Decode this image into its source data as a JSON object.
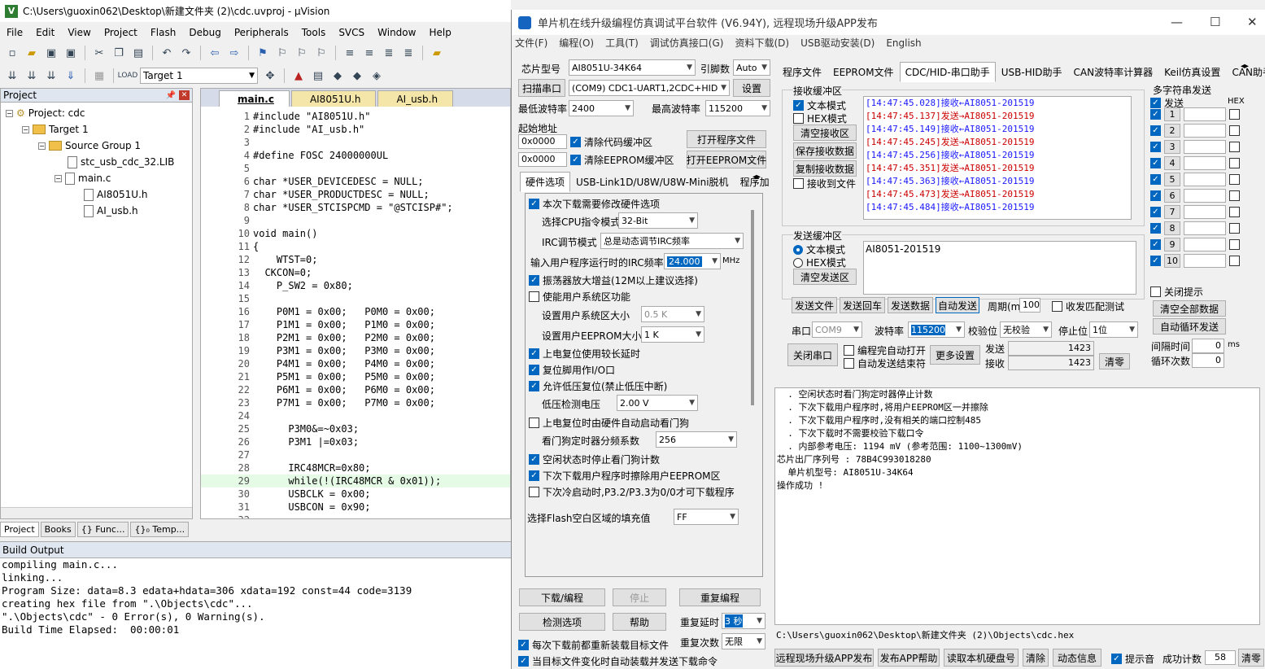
{
  "uv": {
    "title": "C:\\Users\\guoxin062\\Desktop\\新建文件夹 (2)\\cdc.uvproj - µVision",
    "menu": [
      "File",
      "Edit",
      "View",
      "Project",
      "Flash",
      "Debug",
      "Peripherals",
      "Tools",
      "SVCS",
      "Window",
      "Help"
    ],
    "target": "Target 1",
    "project_panel": {
      "title": "Project",
      "root": "Project: cdc",
      "target": "Target 1",
      "group": "Source Group 1",
      "files": [
        "stc_usb_cdc_32.LIB",
        "main.c",
        "AI8051U.h",
        "AI_usb.h"
      ]
    },
    "panel_tabs": [
      "Project",
      "Books",
      "{} Func...",
      "{}₀ Temp..."
    ],
    "editor_tabs": [
      "main.c",
      "AI8051U.h",
      "AI_usb.h"
    ],
    "code": [
      {
        "n": "1",
        "t": "#include \"AI8051U.h\""
      },
      {
        "n": "2",
        "t": "#include \"AI_usb.h\""
      },
      {
        "n": "3",
        "t": ""
      },
      {
        "n": "4",
        "t": "#define FOSC 24000000UL"
      },
      {
        "n": "5",
        "t": ""
      },
      {
        "n": "6",
        "t": "char *USER_DEVICEDESC = NULL;"
      },
      {
        "n": "7",
        "t": "char *USER_PRODUCTDESC = NULL;"
      },
      {
        "n": "8",
        "t": "char *USER_STCISPCMD = \"@STCISP#\";"
      },
      {
        "n": "9",
        "t": ""
      },
      {
        "n": "10",
        "t": "void main()"
      },
      {
        "n": "11",
        "t": "{"
      },
      {
        "n": "12",
        "t": "    WTST=0;"
      },
      {
        "n": "13",
        "t": "  CKCON=0;"
      },
      {
        "n": "14",
        "t": "    P_SW2 = 0x80;"
      },
      {
        "n": "15",
        "t": ""
      },
      {
        "n": "16",
        "t": "    P0M1 = 0x00;   P0M0 = 0x00;"
      },
      {
        "n": "17",
        "t": "    P1M1 = 0x00;   P1M0 = 0x00;"
      },
      {
        "n": "18",
        "t": "    P2M1 = 0x00;   P2M0 = 0x00;"
      },
      {
        "n": "19",
        "t": "    P3M1 = 0x00;   P3M0 = 0x00;"
      },
      {
        "n": "20",
        "t": "    P4M1 = 0x00;   P4M0 = 0x00;"
      },
      {
        "n": "21",
        "t": "    P5M1 = 0x00;   P5M0 = 0x00;"
      },
      {
        "n": "22",
        "t": "    P6M1 = 0x00;   P6M0 = 0x00;"
      },
      {
        "n": "23",
        "t": "    P7M1 = 0x00;   P7M0 = 0x00;"
      },
      {
        "n": "24",
        "t": ""
      },
      {
        "n": "25",
        "t": "      P3M0&=~0x03;"
      },
      {
        "n": "26",
        "t": "      P3M1 |=0x03;"
      },
      {
        "n": "27",
        "t": ""
      },
      {
        "n": "28",
        "t": "      IRC48MCR=0x80;"
      },
      {
        "n": "29",
        "t": "      while(!(IRC48MCR & 0x01));"
      },
      {
        "n": "30",
        "t": "      USBCLK = 0x00;"
      },
      {
        "n": "31",
        "t": "      USBCON = 0x90;"
      },
      {
        "n": "32",
        "t": ""
      }
    ],
    "build_title": "Build Output",
    "build": [
      "compiling main.c...",
      "linking...",
      "Program Size: data=8.3 edata+hdata=306 xdata=192 const=44 code=3139",
      "creating hex file from \".\\Objects\\cdc\"...",
      "\".\\Objects\\cdc\" - 0 Error(s), 0 Warning(s).",
      "Build Time Elapsed:  00:00:01"
    ]
  },
  "stc": {
    "title": "单片机在线升级编程仿真调试平台软件 (V6.94Y), 远程现场升级APP发布",
    "menu": [
      "文件(F)",
      "编程(O)",
      "工具(T)",
      "调试仿真接口(G)",
      "资料下载(D)",
      "USB驱动安装(D)",
      "English"
    ],
    "chip_label": "芯片型号",
    "chip": "AI8051U-34K64",
    "pins_label": "引脚数",
    "pins": "Auto",
    "scan_btn": "扫描串口",
    "port": "(COM9) CDC1-UART1,2CDC+HID",
    "settings_btn": "设置",
    "min_baud_label": "最低波特率",
    "min_baud": "2400",
    "max_baud_label": "最高波特率",
    "max_baud": "115200",
    "start_addr_label": "起始地址",
    "addr1": "0x0000",
    "addr2": "0x0000",
    "clear_code": "清除代码缓冲区",
    "clear_eeprom": "清除EEPROM缓冲区",
    "open_prog": "打开程序文件",
    "open_eeprom": "打开EEPROM文件",
    "hw_tabs": [
      "硬件选项",
      "USB-Link1D/U8W/U8W-Mini脱机",
      "程序加"
    ],
    "hw": {
      "o1": "本次下载需要修改硬件选项",
      "cpu_label": "选择CPU指令模式",
      "cpu": "32-Bit",
      "irc_label": "IRC调节模式",
      "irc": "总是动态调节IRC频率",
      "freq_label": "输入用户程序运行时的IRC频率",
      "freq": "24.000",
      "freq_unit": "MHz",
      "o2": "振荡器放大增益(12M以上建议选择)",
      "o3": "使能用户系统区功能",
      "sys_label": "设置用户系统区大小",
      "sys": "0.5 K",
      "eep_label": "设置用户EEPROM大小",
      "eep": "1  K",
      "o4": "上电复位使用较长延时",
      "o5": "复位脚用作I/O口",
      "o6": "允许低压复位(禁止低压中断)",
      "lv_label": "低压检测电压",
      "lv": "2.00 V",
      "o7": "上电复位时由硬件自动启动看门狗",
      "wd_label": "看门狗定时器分频系数",
      "wd": "256",
      "o8": "空闲状态时停止看门狗计数",
      "o9": "下次下载用户程序时擦除用户EEPROM区",
      "o10": "下次冷启动时,P3.2/P3.3为0/0才可下载程序",
      "fill_label": "选择Flash空白区域的填充值",
      "fill": "FF"
    },
    "download_btn": "下载/编程",
    "stop_btn": "停止",
    "reprog_btn": "重复编程",
    "check_btn": "检测选项",
    "help_btn": "帮助",
    "delay_label": "重复延时",
    "delay": "3 秒",
    "count_label": "重复次数",
    "count": "无限",
    "opt_reload": "每次下载前都重新装载目标文件",
    "opt_auto": "当目标文件变化时自动装载并发送下载命令",
    "right_tabs": [
      "程序文件",
      "EEPROM文件",
      "CDC/HID-串口助手",
      "USB-HID助手",
      "CAN波特率计算器",
      "Keil仿真设置",
      "CAN助手",
      "范"
    ],
    "rx_title": "接收缓冲区",
    "rx_text": "文本模式",
    "rx_hex": "HEX模式",
    "rx_clear": "清空接收区",
    "rx_save": "保存接收数据",
    "rx_copy": "复制接收数据",
    "rx_tofile": "接收到文件",
    "rx_lines": [
      {
        "ts": "[14:47:45.028]",
        "dir": "接收←",
        "msg": "AI8051-201519",
        "send": false
      },
      {
        "ts": "[14:47:45.137]",
        "dir": "发送→",
        "msg": "AI8051-201519",
        "send": true
      },
      {
        "ts": "[14:47:45.149]",
        "dir": "接收←",
        "msg": "AI8051-201519",
        "send": false
      },
      {
        "ts": "[14:47:45.245]",
        "dir": "发送→",
        "msg": "AI8051-201519",
        "send": true
      },
      {
        "ts": "[14:47:45.256]",
        "dir": "接收←",
        "msg": "AI8051-201519",
        "send": false
      },
      {
        "ts": "[14:47:45.351]",
        "dir": "发送→",
        "msg": "AI8051-201519",
        "send": true
      },
      {
        "ts": "[14:47:45.363]",
        "dir": "接收←",
        "msg": "AI8051-201519",
        "send": false
      },
      {
        "ts": "[14:47:45.473]",
        "dir": "发送→",
        "msg": "AI8051-201519",
        "send": true
      },
      {
        "ts": "[14:47:45.484]",
        "dir": "接收←",
        "msg": "AI8051-201519",
        "send": false
      }
    ],
    "tx_title": "发送缓冲区",
    "tx_text": "文本模式",
    "tx_hex": "HEX模式",
    "tx_clear": "清空发送区",
    "tx_value": "AI8051-201519",
    "send_file": "发送文件",
    "send_cr": "发送回车",
    "send_data": "发送数据",
    "auto_send": "自动发送",
    "period_label": "周期(ms)",
    "period": "100",
    "recv_match": "收发匹配测试",
    "com_label": "串口",
    "com": "COM9",
    "baud_label": "波特率",
    "baud": "115200",
    "parity_label": "校验位",
    "parity": "无校验",
    "stop_label": "停止位",
    "stopbits": "1位",
    "close_port": "关闭串口",
    "auto_open": "编程完自动打开",
    "auto_end": "自动发送结束符",
    "more": "更多设置",
    "tx_count_label": "发送",
    "tx_count": "1423",
    "rx_count_label": "接收",
    "rx_count": "1423",
    "zero_btn": "清零",
    "multi_title": "多字符串发送",
    "multi_send": "发送",
    "multi_hex": "HEX",
    "multi_rows": [
      "1",
      "2",
      "3",
      "4",
      "5",
      "6",
      "7",
      "8",
      "9",
      "10"
    ],
    "close_tip": "关闭提示",
    "clear_all": "清空全部数据",
    "auto_loop": "自动循环发送",
    "interval_label": "间隔时间",
    "interval": "0",
    "interval_unit": "ms",
    "loops_label": "循环次数",
    "loops": "0",
    "log": [
      "  . 空闲状态时看门狗定时器停止计数",
      "  . 下次下载用户程序时,将用户EEPROM区一并擦除",
      "  . 下次下载用户程序时,没有相关的端口控制485",
      "  . 下次下载时不需要校验下载口令",
      "  . 内部参考电压: 1194 mV (参考范围: 1100~1300mV)",
      "芯片出厂序列号 : 78B4C993018280",
      "",
      "  单片机型号: AI8051U-34K64",
      "",
      "操作成功 !"
    ],
    "path": "C:\\Users\\guoxin062\\Desktop\\新建文件夹 (2)\\Objects\\cdc.hex",
    "bottom": {
      "remote": "远程现场升级APP发布",
      "app_help": "发布APP帮助",
      "read_disk": "读取本机硬盘号",
      "clear": "清除",
      "dynamic": "动态信息",
      "beep": "提示音",
      "success_label": "成功计数",
      "success": "58",
      "zero": "清零"
    }
  }
}
